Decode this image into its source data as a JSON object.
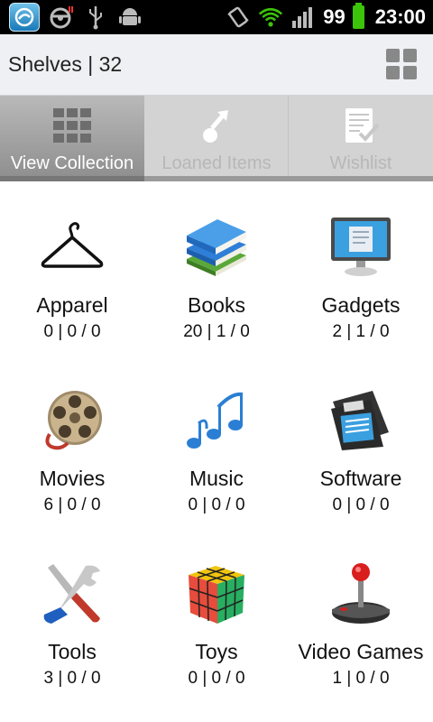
{
  "status_bar": {
    "icons": [
      "app-logo-icon",
      "steering-wheel-icon",
      "usb-icon",
      "android-debug-icon",
      "vibrate-icon",
      "wifi-icon",
      "signal-icon"
    ],
    "battery_level": "99",
    "time": "23:00"
  },
  "action_bar": {
    "title": "Shelves | 32",
    "grid_icon": "grid-view-icon"
  },
  "tabs": [
    {
      "label": "View Collection",
      "icon": "collection-grid-icon",
      "active": true
    },
    {
      "label": "Loaned Items",
      "icon": "loan-arrow-icon",
      "active": false
    },
    {
      "label": "Wishlist",
      "icon": "wishlist-clipboard-icon",
      "active": false
    }
  ],
  "shelves": [
    {
      "name": "Apparel",
      "counts": "0 | 0 / 0",
      "icon": "hanger-icon"
    },
    {
      "name": "Books",
      "counts": "20 | 1 / 0",
      "icon": "books-icon"
    },
    {
      "name": "Gadgets",
      "counts": "2 | 1 / 0",
      "icon": "monitor-icon"
    },
    {
      "name": "Movies",
      "counts": "6 | 0 / 0",
      "icon": "film-reel-icon"
    },
    {
      "name": "Music",
      "counts": "0 | 0 / 0",
      "icon": "music-notes-icon"
    },
    {
      "name": "Software",
      "counts": "0 | 0 / 0",
      "icon": "floppy-disk-icon"
    },
    {
      "name": "Tools",
      "counts": "3 | 0 / 0",
      "icon": "tools-icon"
    },
    {
      "name": "Toys",
      "counts": "0 | 0 / 0",
      "icon": "rubiks-cube-icon"
    },
    {
      "name": "Video Games",
      "counts": "1 | 0 / 0",
      "icon": "joystick-icon"
    }
  ],
  "colors": {
    "status_bar_bg": "#000000",
    "action_bar_bg": "#eef0f3",
    "active_tab_bg": "#9e9e9e",
    "inactive_tab_text": "#b7b7b7",
    "battery": "#3cc40a",
    "wifi": "#3cc40a"
  }
}
